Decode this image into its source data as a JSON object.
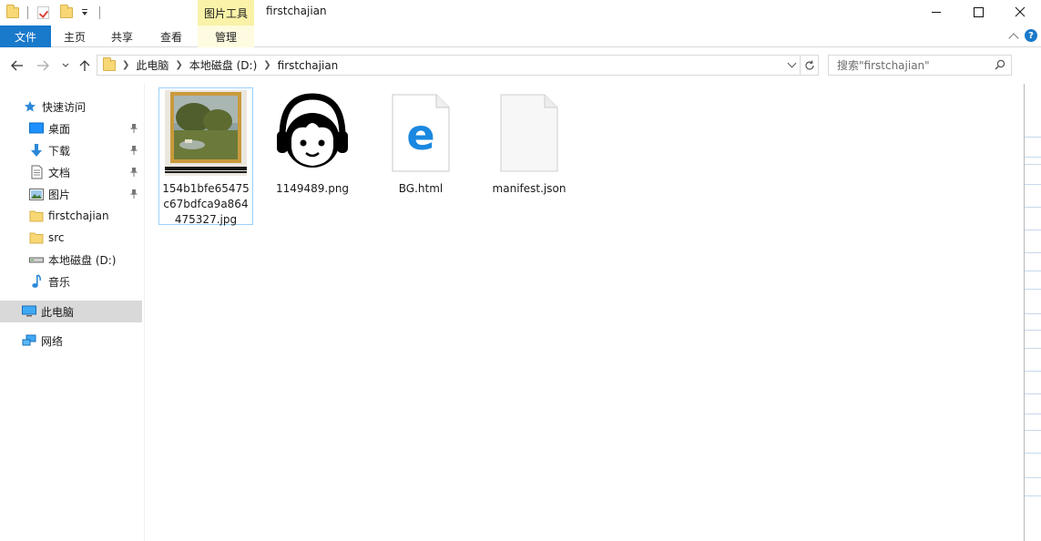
{
  "titlebar": {
    "contextual_group": "图片工具",
    "title": "firstchajian"
  },
  "ribbon": {
    "tabs": [
      {
        "label": "文件"
      },
      {
        "label": "主页"
      },
      {
        "label": "共享"
      },
      {
        "label": "查看"
      },
      {
        "label": "管理"
      }
    ],
    "help_label": "?"
  },
  "address": {
    "crumbs": [
      "此电脑",
      "本地磁盘 (D:)",
      "firstchajian"
    ]
  },
  "search": {
    "placeholder": "搜索\"firstchajian\""
  },
  "sidebar": {
    "items": [
      {
        "label": "快速访问",
        "icon": "star-icon"
      },
      {
        "label": "桌面",
        "icon": "desktop-icon",
        "pinned": true
      },
      {
        "label": "下载",
        "icon": "download-icon",
        "pinned": true
      },
      {
        "label": "文档",
        "icon": "document-icon",
        "pinned": true
      },
      {
        "label": "图片",
        "icon": "pictures-icon",
        "pinned": true
      },
      {
        "label": "firstchajian",
        "icon": "folder-icon"
      },
      {
        "label": "src",
        "icon": "folder-icon"
      },
      {
        "label": "本地磁盘 (D:)",
        "icon": "drive-icon"
      },
      {
        "label": "音乐",
        "icon": "music-icon"
      },
      {
        "label": "此电脑",
        "icon": "computer-icon"
      },
      {
        "label": "网络",
        "icon": "network-icon"
      }
    ]
  },
  "files": [
    {
      "name": "154b1bfe65475c67bdfca9a864475327.jpg",
      "lines": [
        "154b1bfe65475",
        "c67bdfca9a864",
        "475327.jpg"
      ],
      "icon": "landscape-painting-thumbnail"
    },
    {
      "name": "1149489.png",
      "lines": [
        "1149489.png"
      ],
      "icon": "headphones-face-thumbnail"
    },
    {
      "name": "BG.html",
      "lines": [
        "BG.html"
      ],
      "icon": "edge-html-icon"
    },
    {
      "name": "manifest.json",
      "lines": [
        "manifest.json"
      ],
      "icon": "blank-file-icon"
    }
  ],
  "colors": {
    "file_tab": "#1979ca",
    "context_tab": "#f9f2a8",
    "selection_border": "#99d1ff",
    "nav_selected": "#d9d9d9"
  }
}
